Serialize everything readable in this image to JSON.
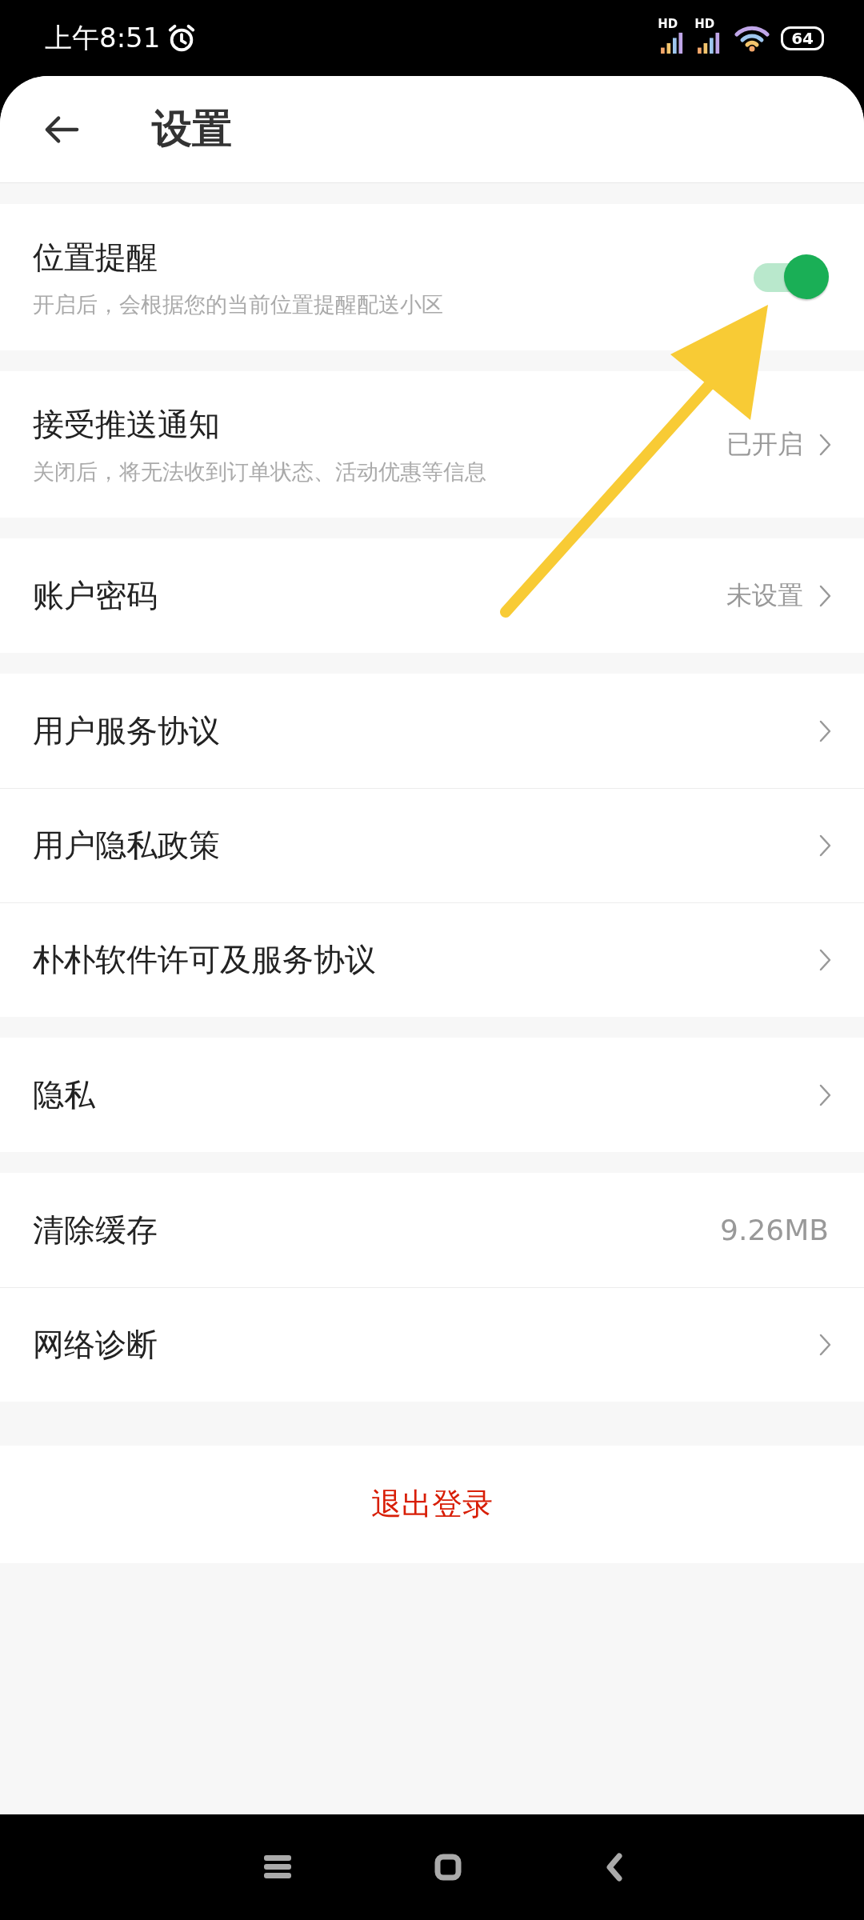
{
  "status_bar": {
    "time": "上午8:51",
    "signals": [
      {
        "label": "HD"
      },
      {
        "label": "HD"
      }
    ],
    "battery": "64"
  },
  "header": {
    "title": "设置"
  },
  "groups": [
    {
      "items": [
        {
          "kind": "toggle",
          "label": "位置提醒",
          "subtitle": "开启后，会根据您的当前位置提醒配送小区",
          "on": true
        }
      ]
    },
    {
      "items": [
        {
          "kind": "link",
          "label": "接受推送通知",
          "subtitle": "关闭后，将无法收到订单状态、活动优惠等信息",
          "value": "已开启"
        }
      ]
    },
    {
      "items": [
        {
          "kind": "link",
          "label": "账户密码",
          "value": "未设置"
        }
      ]
    },
    {
      "items": [
        {
          "kind": "link",
          "label": "用户服务协议"
        },
        {
          "kind": "link",
          "label": "用户隐私政策"
        },
        {
          "kind": "link",
          "label": "朴朴软件许可及服务协议"
        }
      ]
    },
    {
      "items": [
        {
          "kind": "link",
          "label": "隐私"
        }
      ]
    },
    {
      "items": [
        {
          "kind": "value",
          "label": "清除缓存",
          "value": "9.26MB"
        },
        {
          "kind": "link",
          "label": "网络诊断"
        }
      ]
    }
  ],
  "logout": {
    "label": "退出登录"
  },
  "annotation": {
    "kind": "arrow"
  }
}
